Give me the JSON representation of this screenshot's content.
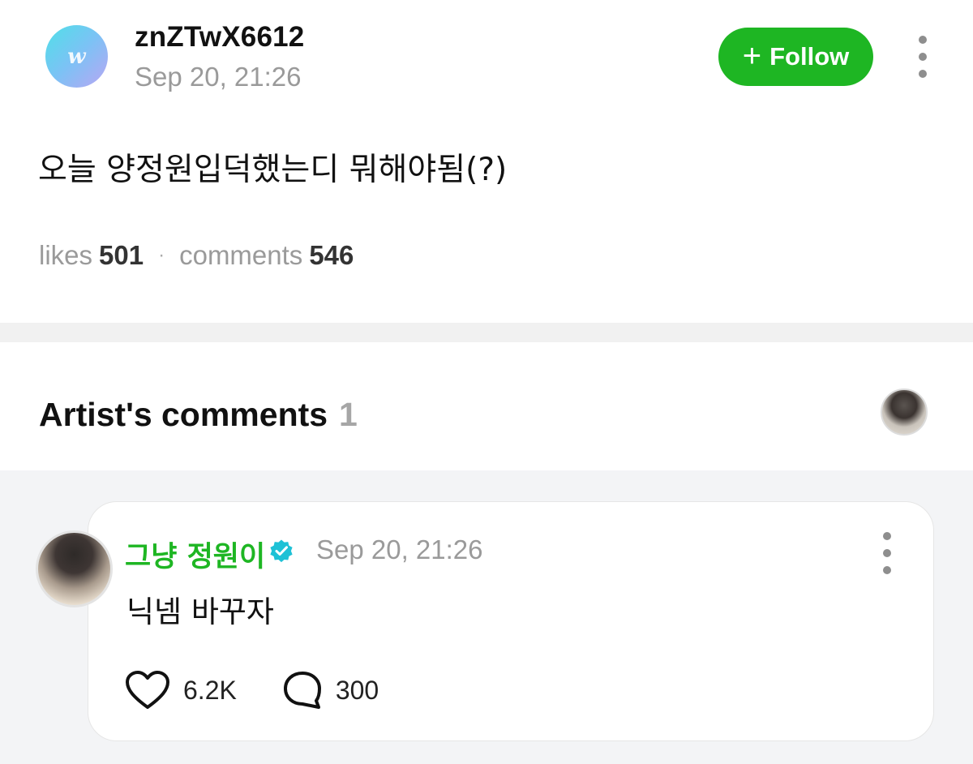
{
  "post": {
    "avatar_letter": "w",
    "username": "znZTwX6612",
    "timestamp": "Sep 20, 21:26",
    "follow_label": "Follow",
    "body": "오늘 양정원입덕했는디 뭐해야됨(?)",
    "likes_label": "likes",
    "likes_count": "501",
    "separator": "·",
    "comments_label": "comments",
    "comments_count": "546"
  },
  "artist_comments": {
    "title": "Artist's comments",
    "count": "1",
    "items": [
      {
        "author": "그냥 정원이",
        "verified": true,
        "timestamp": "Sep 20, 21:26",
        "text": "닉넴 바꾸자",
        "likes": "6.2K",
        "replies": "300"
      }
    ]
  },
  "colors": {
    "brand_green": "#1eb623",
    "verified_teal": "#1ec1d6",
    "muted_text": "#9a9a9a",
    "section_bg": "#f3f4f6"
  },
  "icons": [
    "plus-icon",
    "more-vertical-icon",
    "verified-badge-icon",
    "heart-icon",
    "comment-bubble-icon"
  ]
}
